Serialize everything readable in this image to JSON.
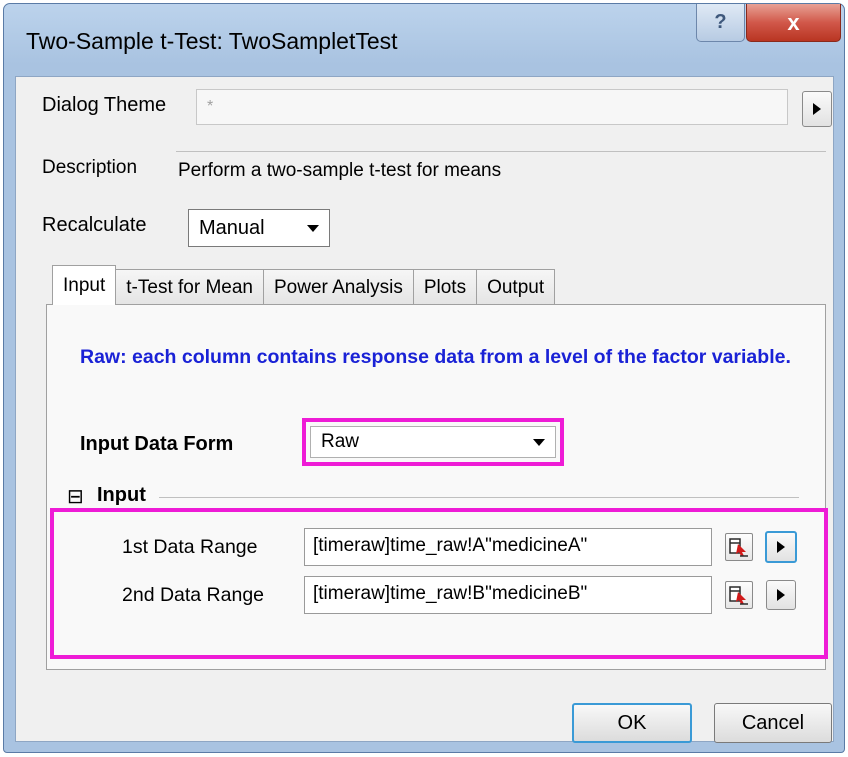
{
  "window": {
    "title": "Two-Sample t-Test: TwoSampletTest",
    "help_glyph": "?",
    "close_glyph": "x"
  },
  "theme": {
    "label": "Dialog Theme",
    "value": "*"
  },
  "description": {
    "label": "Description",
    "text": "Perform a two-sample t-test for means"
  },
  "recalculate": {
    "label": "Recalculate",
    "value": "Manual"
  },
  "tabs": [
    {
      "label": "Input",
      "active": true
    },
    {
      "label": "t-Test for Mean",
      "active": false
    },
    {
      "label": "Power Analysis",
      "active": false
    },
    {
      "label": "Plots",
      "active": false
    },
    {
      "label": "Output",
      "active": false
    }
  ],
  "input_tab": {
    "info": "Raw: each column contains response data from a level of the factor variable.",
    "data_form": {
      "label": "Input Data Form",
      "value": "Raw"
    },
    "group": {
      "toggle": "⊟",
      "label": "Input"
    },
    "range1": {
      "label": "1st Data Range",
      "value": "[timeraw]time_raw!A\"medicineA\""
    },
    "range2": {
      "label": "2nd Data Range",
      "value": "[timeraw]time_raw!B\"medicineB\""
    }
  },
  "buttons": {
    "ok": "OK",
    "cancel": "Cancel"
  },
  "colors": {
    "highlight": "#ee1cd6",
    "info_text": "#1a22d6",
    "close_button": "#c7402f"
  },
  "icons": [
    "help-icon",
    "close-icon",
    "arrow-right-icon",
    "dropdown-arrow-icon",
    "collapse-icon",
    "range-picker-icon"
  ]
}
